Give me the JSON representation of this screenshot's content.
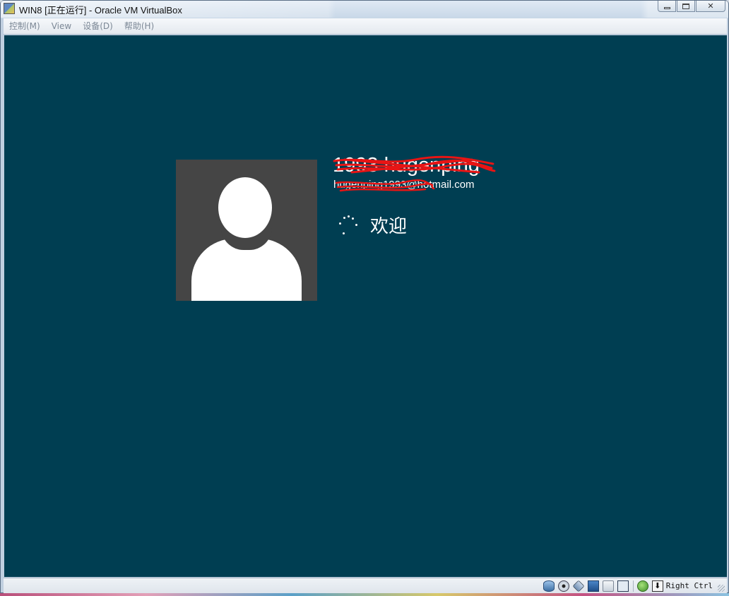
{
  "window": {
    "title": "WIN8 [正在运行] - Oracle VM VirtualBox",
    "app_icon": "virtualbox-icon",
    "controls": [
      "minimize-icon",
      "maximize-icon",
      "close-icon"
    ],
    "close_glyph": "✕"
  },
  "menu": {
    "items": [
      {
        "label": "控制(M)"
      },
      {
        "label": "View"
      },
      {
        "label": "设备(D)"
      },
      {
        "label": "帮助(H)"
      }
    ]
  },
  "vm": {
    "background_color": "#003e52",
    "avatar_icon": "user-avatar-icon",
    "user_name": "1993 hugenping",
    "user_email": "hugenping1993@hotmail.com",
    "status_text": "欢迎",
    "redaction_color": "#e81414"
  },
  "statusbar": {
    "icons": [
      "hard-disk-icon",
      "optical-drive-icon",
      "usb-icon",
      "network-icon",
      "shared-folders-icon",
      "cpu-icon",
      "mouse-integration-icon",
      "keyboard-capture-icon"
    ],
    "keyboard_glyph": "⬇",
    "host_key_label": "Right Ctrl"
  }
}
